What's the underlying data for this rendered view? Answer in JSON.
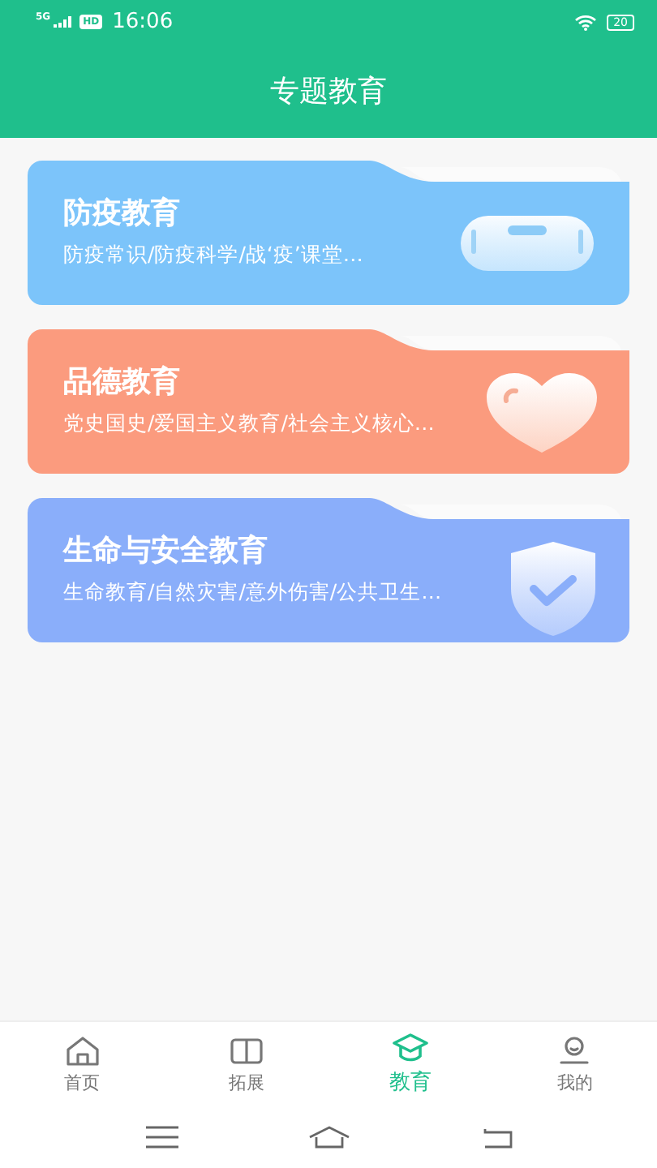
{
  "status_bar": {
    "network": "5G",
    "hd": "HD",
    "time": "16:06",
    "battery": "20"
  },
  "header": {
    "title": "专题教育"
  },
  "topics": [
    {
      "kind": "mask",
      "title": "防疫教育",
      "subtitle": "防疫常识/防疫科学/战‘疫’课堂…",
      "color": "#7cc4fa"
    },
    {
      "kind": "heart",
      "title": "品德教育",
      "subtitle": "党史国史/爱国主义教育/社会主义核心…",
      "color": "#fb9b7e"
    },
    {
      "kind": "shield",
      "title": "生命与安全教育",
      "subtitle": "生命教育/自然灾害/意外伤害/公共卫生…",
      "color": "#8aaefa"
    }
  ],
  "tab_bar": [
    {
      "kind": "home",
      "label": "首页",
      "selected": false
    },
    {
      "kind": "book",
      "label": "拓展",
      "selected": false
    },
    {
      "kind": "cap",
      "label": "教育",
      "selected": true
    },
    {
      "kind": "person",
      "label": "我的",
      "selected": false
    }
  ]
}
